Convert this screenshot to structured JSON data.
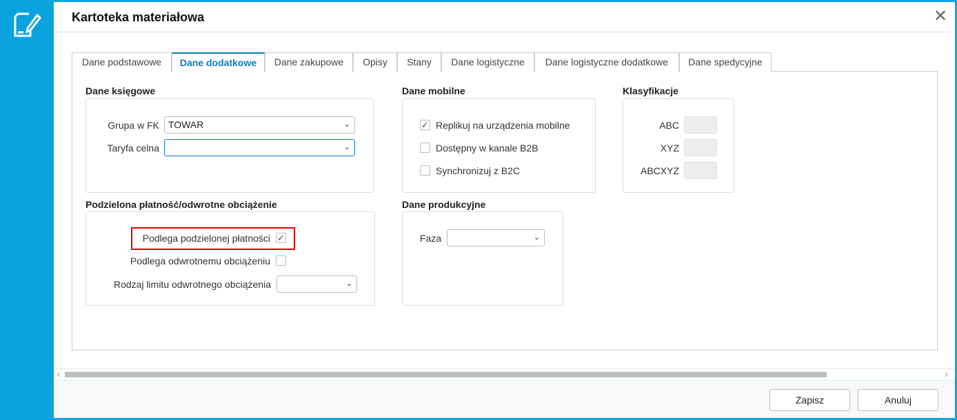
{
  "window": {
    "title": "Kartoteka materiałowa",
    "close_icon": "close-icon",
    "app_icon": "document-edit-icon"
  },
  "tabs": [
    {
      "label": "Dane podstawowe",
      "active": false
    },
    {
      "label": "Dane dodatkowe",
      "active": true
    },
    {
      "label": "Dane zakupowe",
      "active": false
    },
    {
      "label": "Opisy",
      "active": false
    },
    {
      "label": "Stany",
      "active": false
    },
    {
      "label": "Dane logistyczne",
      "active": false
    },
    {
      "label": "Dane logistyczne dodatkowe",
      "active": false
    },
    {
      "label": "Dane spedycyjne",
      "active": false
    }
  ],
  "ksiegowe": {
    "title": "Dane księgowe",
    "grupa_label": "Grupa w FK",
    "grupa_value": "TOWAR",
    "taryfa_label": "Taryfa celna",
    "taryfa_value": ""
  },
  "mobilne": {
    "title": "Dane mobilne",
    "items": [
      {
        "label": "Replikuj na urządzenia mobilne",
        "checked": true
      },
      {
        "label": "Dostępny w kanale B2B",
        "checked": false
      },
      {
        "label": "Synchronizuj z B2C",
        "checked": false
      }
    ]
  },
  "klasyfikacje": {
    "title": "Klasyfikacje",
    "abc": "ABC",
    "xyz": "XYZ",
    "abcxyz": "ABCXYZ"
  },
  "podzielona": {
    "title": "Podzielona płatność/odwrotne obciążenie",
    "split_label": "Podlega podzielonej płatności",
    "split_checked": true,
    "reverse_label": "Podlega odwrotnemu obciążeniu",
    "reverse_checked": false,
    "limit_label": "Rodzaj limitu odwrotnego obciążenia",
    "limit_value": ""
  },
  "produkcyjne": {
    "title": "Dane produkcyjne",
    "faza_label": "Faza",
    "faza_value": ""
  },
  "footer": {
    "save": "Zapisz",
    "cancel": "Anuluj"
  },
  "glyphs": {
    "chev": "⌄",
    "check": "✓",
    "close": "✕",
    "left": "‹",
    "right": "›"
  }
}
